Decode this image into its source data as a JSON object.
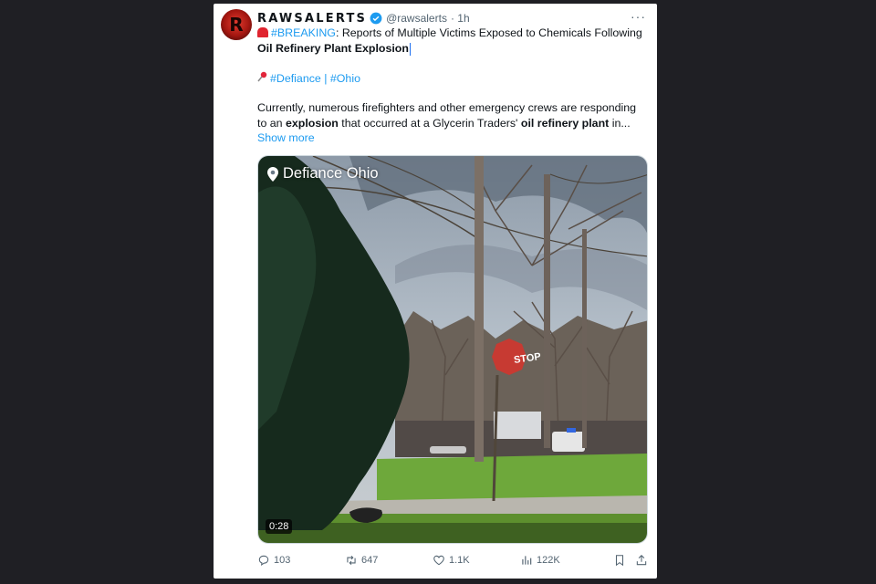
{
  "tweet": {
    "name": "RAWSALERTS",
    "handle": "@rawsalerts",
    "time": "· 1h",
    "more": "···",
    "line1_prefix": "#BREAKING",
    "line1_mid": ": Reports of Multiple Victims Exposed to Chemicals Following ",
    "line1_bold": "Oil Refinery Plant Explosion",
    "tag1": "#Defiance",
    "tag_sep": " | ",
    "tag2": "#Ohio",
    "body_a": "Currently, numerous firefighters and other emergency crews are responding to an ",
    "body_b": "explosion",
    "body_c": " that occurred at a Glycerin Traders' ",
    "body_d": "oil refinery plant",
    "body_e": " in...",
    "show_more": "Show more"
  },
  "media": {
    "location": "Defiance Ohio",
    "duration": "0:28",
    "stop": "STOP"
  },
  "actions": {
    "replies": "103",
    "reposts": "647",
    "likes": "1.1K",
    "views": "122K"
  },
  "colors": {
    "link": "#1d9bf0",
    "background": "#1f1f24"
  },
  "icons": [
    "alarm-light-icon",
    "pushpin-icon",
    "verified-badge-icon",
    "location-pin-icon",
    "reply-icon",
    "repost-icon",
    "like-icon",
    "views-icon",
    "bookmark-icon",
    "share-icon",
    "more-icon"
  ]
}
